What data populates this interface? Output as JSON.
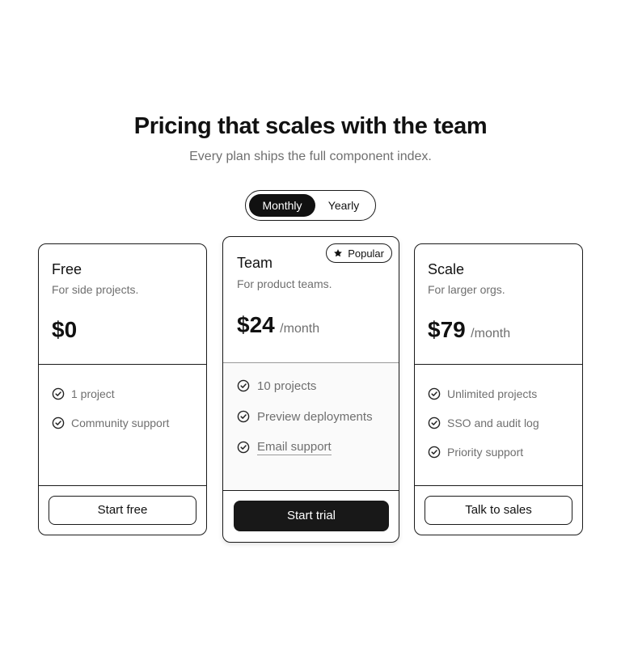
{
  "header": {
    "title": "Pricing that scales with the team",
    "subtitle": "Every plan ships the full component index."
  },
  "billing_toggle": {
    "options": [
      "Monthly",
      "Yearly"
    ],
    "selected": "Monthly"
  },
  "plans": [
    {
      "name": "Free",
      "description": "For side projects.",
      "price": "$0",
      "period": "",
      "features": [
        "1 project",
        "Community support"
      ],
      "cta": "Start free"
    },
    {
      "name": "Team",
      "description": "For product teams.",
      "price": "$24",
      "period": "/month",
      "badge": "Popular",
      "features": [
        "10 projects",
        "Preview deployments",
        "Email support"
      ],
      "cta": "Start trial"
    },
    {
      "name": "Scale",
      "description": "For larger orgs.",
      "price": "$79",
      "period": "/month",
      "features": [
        "Unlimited projects",
        "SSO and audit log",
        "Priority support"
      ],
      "cta": "Talk to sales"
    }
  ],
  "icons": {
    "feature": "check-circle-icon",
    "badge": "star-icon"
  },
  "colors": {
    "text": "#111111",
    "muted": "#6f6f6f",
    "accent": "#181818",
    "background": "#ffffff"
  }
}
